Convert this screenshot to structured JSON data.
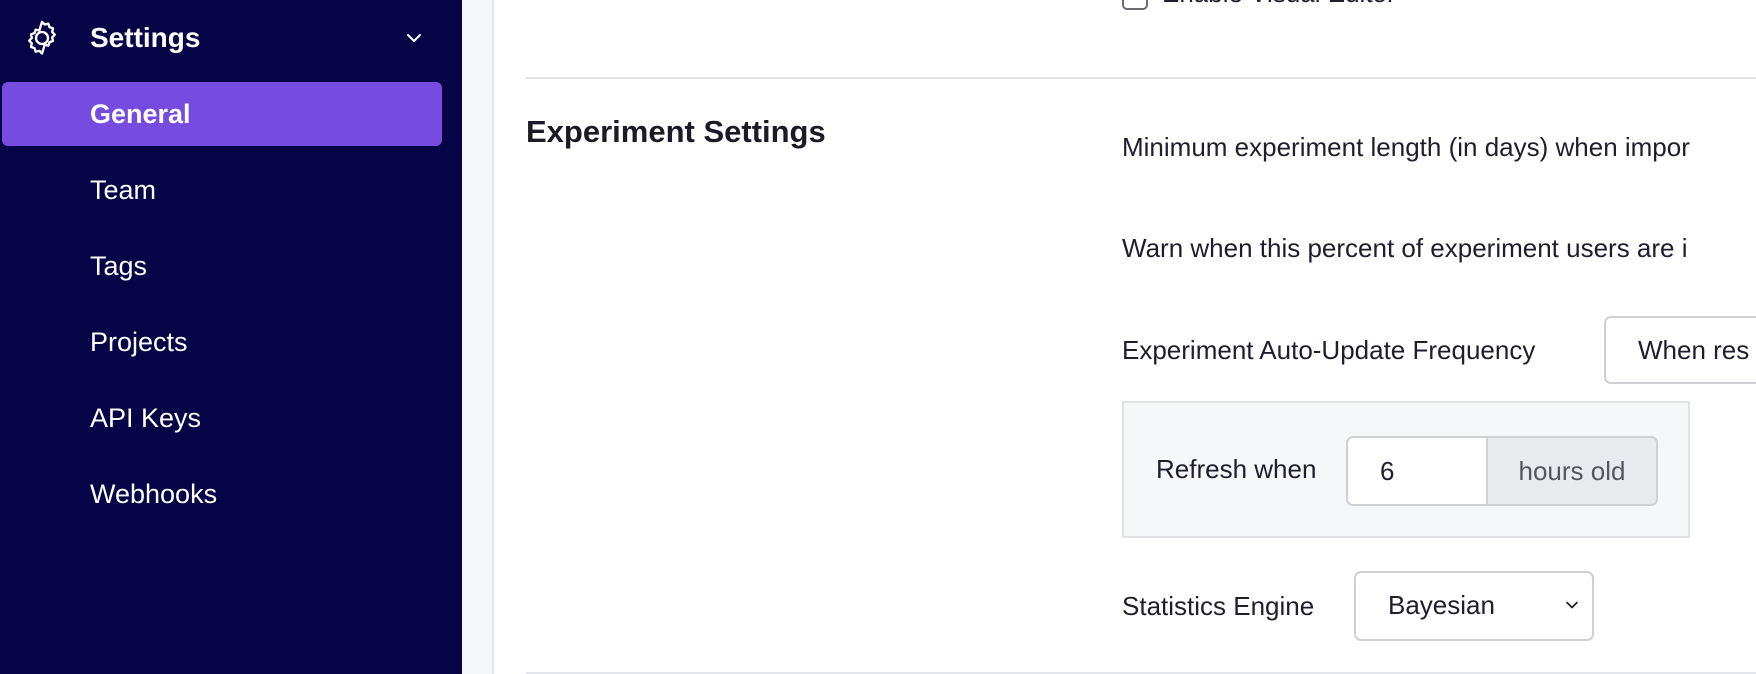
{
  "sidebar": {
    "header": {
      "title": "Settings",
      "icon": "gear-icon",
      "toggle_icon": "chevron-down-icon"
    },
    "items": [
      {
        "label": "General",
        "active": true
      },
      {
        "label": "Team",
        "active": false
      },
      {
        "label": "Tags",
        "active": false
      },
      {
        "label": "Projects",
        "active": false
      },
      {
        "label": "API Keys",
        "active": false
      },
      {
        "label": "Webhooks",
        "active": false
      }
    ],
    "colors": {
      "background": "#070347",
      "active": "#764be0"
    }
  },
  "main": {
    "previous_section": {
      "visual_editor_checkbox": {
        "label": "Enable Visual Editor",
        "checked": false
      }
    },
    "experiment_settings": {
      "title": "Experiment Settings",
      "min_length_label": "Minimum experiment length (in days) when impor",
      "warn_percent_label": "Warn when this percent of experiment users are i",
      "auto_update": {
        "label": "Experiment Auto-Update Frequency",
        "selected": "When res"
      },
      "refresh": {
        "label": "Refresh when",
        "value": "6",
        "unit": "hours old"
      },
      "stats_engine": {
        "label": "Statistics Engine",
        "selected": "Bayesian"
      }
    }
  }
}
